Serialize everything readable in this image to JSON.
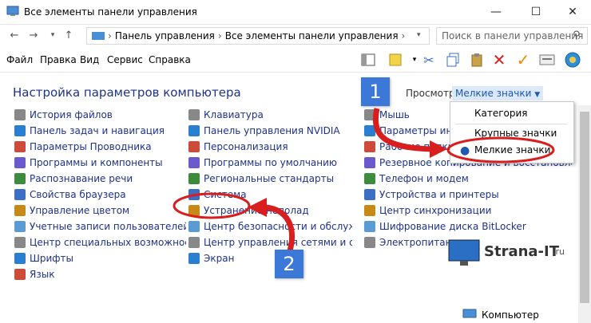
{
  "window": {
    "title": "Все элементы панели управления",
    "min": "—",
    "max": "☐",
    "close": "✕"
  },
  "address": {
    "path1": "Панель управления",
    "path2": "Все элементы панели управления",
    "search_placeholder": "Поиск в панели управления"
  },
  "menu": [
    "Файл",
    "Правка",
    "Вид",
    "Сервис",
    "Справка"
  ],
  "heading": "Настройка параметров компьютера",
  "view": {
    "label": "Просмотр:",
    "selected": "Мелкие значки"
  },
  "dropdown": [
    "Категория",
    "Крупные значки",
    "Мелкие значки"
  ],
  "col1": [
    "История файлов",
    "Панель задач и навигация",
    "Параметры Проводника",
    "Программы и компоненты",
    "Распознавание речи",
    "Свойства браузера",
    "Управление цветом",
    "Учетные записи пользователей",
    "Центр специальных возможностей",
    "Шрифты",
    "Язык"
  ],
  "col2": [
    "Клавиатура",
    "Панель управления NVIDIA",
    "Персонализация",
    "Программы по умолчанию",
    "Региональные стандарты",
    "Система",
    "Устранение неполад",
    "Центр безопасности и обслуживания",
    "Центр управления сетями и общим доступом",
    "Экран"
  ],
  "col3": [
    "Мышь",
    "Параметры индексирования",
    "Рабочие папки",
    "Резервное копирование и восстановление",
    "Телефон и модем",
    "Устройства и принтеры",
    "Центр синхронизации",
    "Шифрование диска BitLocker",
    "Электропитание"
  ],
  "status": "Компьютер",
  "badges": [
    "1",
    "2"
  ],
  "logo": {
    "brand": "Strana-IT",
    "suffix": ".ru"
  },
  "icon_colors": [
    "#3d8b3d",
    "#3a6fc4",
    "#c78a16",
    "#5a9bd4",
    "#888888",
    "#2a7fd0",
    "#d04a3a",
    "#6a5acd"
  ]
}
